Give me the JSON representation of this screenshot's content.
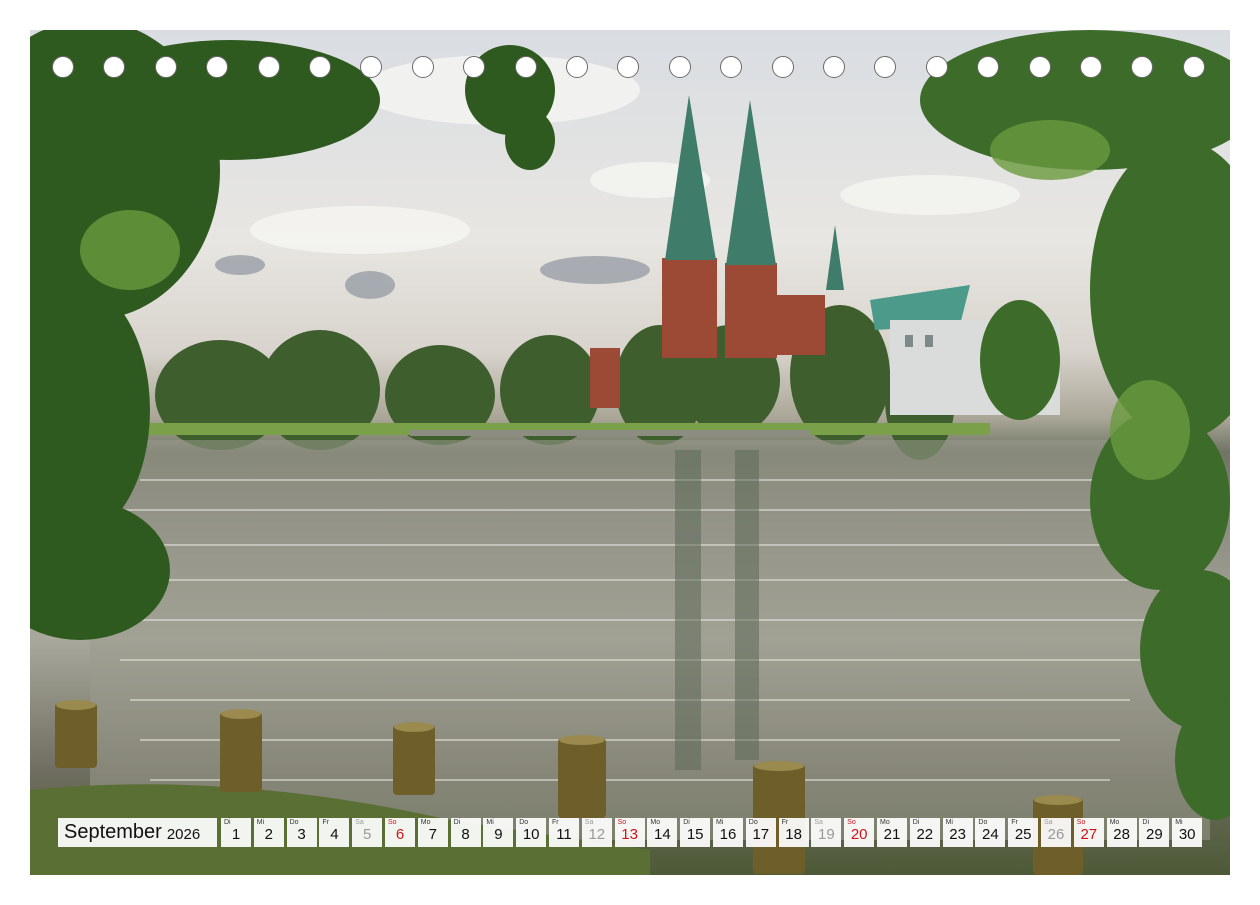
{
  "calendar": {
    "month": "September",
    "year": "2026",
    "days": [
      {
        "wd": "Di",
        "n": "1",
        "kind": "weekday"
      },
      {
        "wd": "Mi",
        "n": "2",
        "kind": "weekday"
      },
      {
        "wd": "Do",
        "n": "3",
        "kind": "weekday"
      },
      {
        "wd": "Fr",
        "n": "4",
        "kind": "weekday"
      },
      {
        "wd": "Sa",
        "n": "5",
        "kind": "sat"
      },
      {
        "wd": "So",
        "n": "6",
        "kind": "sun"
      },
      {
        "wd": "Mo",
        "n": "7",
        "kind": "weekday"
      },
      {
        "wd": "Di",
        "n": "8",
        "kind": "weekday"
      },
      {
        "wd": "Mi",
        "n": "9",
        "kind": "weekday"
      },
      {
        "wd": "Do",
        "n": "10",
        "kind": "weekday"
      },
      {
        "wd": "Fr",
        "n": "11",
        "kind": "weekday"
      },
      {
        "wd": "Sa",
        "n": "12",
        "kind": "sat"
      },
      {
        "wd": "So",
        "n": "13",
        "kind": "sun"
      },
      {
        "wd": "Mo",
        "n": "14",
        "kind": "weekday"
      },
      {
        "wd": "Di",
        "n": "15",
        "kind": "weekday"
      },
      {
        "wd": "Mi",
        "n": "16",
        "kind": "weekday"
      },
      {
        "wd": "Do",
        "n": "17",
        "kind": "weekday"
      },
      {
        "wd": "Fr",
        "n": "18",
        "kind": "weekday"
      },
      {
        "wd": "Sa",
        "n": "19",
        "kind": "sat"
      },
      {
        "wd": "So",
        "n": "20",
        "kind": "sun"
      },
      {
        "wd": "Mo",
        "n": "21",
        "kind": "weekday"
      },
      {
        "wd": "Di",
        "n": "22",
        "kind": "weekday"
      },
      {
        "wd": "Mi",
        "n": "23",
        "kind": "weekday"
      },
      {
        "wd": "Do",
        "n": "24",
        "kind": "weekday"
      },
      {
        "wd": "Fr",
        "n": "25",
        "kind": "weekday"
      },
      {
        "wd": "Sa",
        "n": "26",
        "kind": "sat"
      },
      {
        "wd": "So",
        "n": "27",
        "kind": "sun"
      },
      {
        "wd": "Mo",
        "n": "28",
        "kind": "weekday"
      },
      {
        "wd": "Di",
        "n": "29",
        "kind": "weekday"
      },
      {
        "wd": "Mi",
        "n": "30",
        "kind": "weekday"
      }
    ]
  },
  "binding_hole_count": 23,
  "colors": {
    "sunday": "#d0141a",
    "saturday": "#9a9a9a",
    "weekday": "#111111",
    "spire": "#3f7d6a",
    "brick": "#9c4a35",
    "foliage": "#3d6b2a"
  },
  "photo_subject_icons": [
    "cathedral-icon",
    "lake-icon",
    "tree-icon",
    "wooden-post-icon"
  ]
}
